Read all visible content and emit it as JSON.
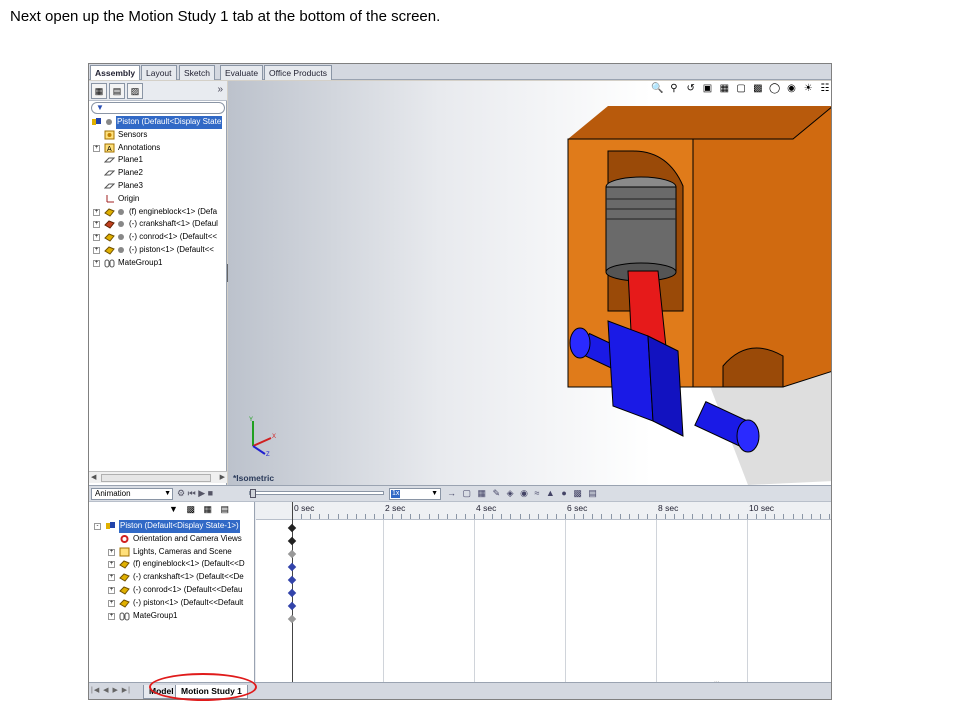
{
  "instruction": "Next open up the Motion Study 1 tab at the bottom of the screen.",
  "command_tabs": [
    "Assembly",
    "Layout",
    "Sketch",
    "Evaluate",
    "Office Products"
  ],
  "feature_tree": {
    "items": [
      {
        "label": "Piston  (Default<Display State",
        "selected": true
      },
      {
        "label": "Sensors"
      },
      {
        "label": "Annotations"
      },
      {
        "label": "Plane1"
      },
      {
        "label": "Plane2"
      },
      {
        "label": "Plane3"
      },
      {
        "label": "Origin"
      },
      {
        "label": "(f) engineblock<1> (Defa"
      },
      {
        "label": "(-) crankshaft<1> (Defaul"
      },
      {
        "label": "(-) conrod<1> (Default<<"
      },
      {
        "label": "(-) piston<1> (Default<<"
      },
      {
        "label": "MateGroup1"
      }
    ]
  },
  "viewport": {
    "view_label": "*Isometric"
  },
  "motion_manager": {
    "study_type": "Animation",
    "speed": "1x",
    "timeline_labels": [
      "0 sec",
      "2 sec",
      "4 sec",
      "6 sec",
      "8 sec",
      "10 sec"
    ],
    "tree": [
      {
        "label": "Piston  (Default<Display State-1>)",
        "selected": true
      },
      {
        "label": "Orientation and Camera Views"
      },
      {
        "label": "Lights, Cameras and Scene"
      },
      {
        "label": "(f) engineblock<1> (Default<<D"
      },
      {
        "label": "(-) crankshaft<1> (Default<<De"
      },
      {
        "label": "(-) conrod<1> (Default<<Defau"
      },
      {
        "label": "(-) piston<1> (Default<<Default"
      },
      {
        "label": "MateGroup1"
      }
    ]
  },
  "bottom_tabs": [
    "Model",
    "Motion Study 1"
  ],
  "colors": {
    "selection": "#3169c6",
    "highlight_oval": "#e01b1b",
    "block": "#e07b1a",
    "crank": "#1a1ae6",
    "rod": "#e61a1a",
    "piston": "#6a6a6a"
  }
}
